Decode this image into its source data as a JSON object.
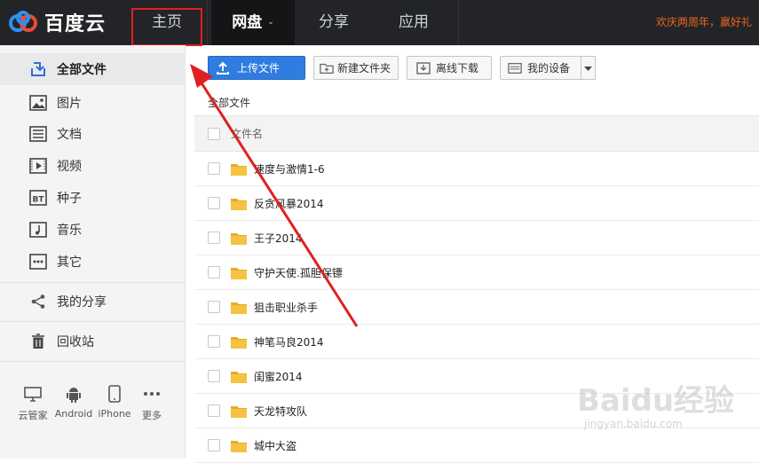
{
  "brand": {
    "name": "百度云"
  },
  "nav": {
    "home": "主页",
    "netdisk": "网盘",
    "share": "分享",
    "apps": "应用"
  },
  "promo": "欢庆两周年，赢好礼",
  "sidebar": {
    "items": [
      {
        "label": "全部文件",
        "icon": "all-files-icon",
        "active": true
      },
      {
        "label": "图片",
        "icon": "image-icon"
      },
      {
        "label": "文档",
        "icon": "document-icon"
      },
      {
        "label": "视频",
        "icon": "video-icon"
      },
      {
        "label": "种子",
        "icon": "torrent-icon"
      },
      {
        "label": "音乐",
        "icon": "music-icon"
      },
      {
        "label": "其它",
        "icon": "other-icon"
      },
      {
        "label": "我的分享",
        "icon": "share-icon"
      },
      {
        "label": "回收站",
        "icon": "trash-icon"
      }
    ],
    "devices": [
      {
        "label": "云管家",
        "icon": "desktop-icon"
      },
      {
        "label": "Android",
        "icon": "android-icon"
      },
      {
        "label": "iPhone",
        "icon": "iphone-icon"
      },
      {
        "label": "更多",
        "icon": "more-icon"
      }
    ]
  },
  "toolbar": {
    "upload": "上传文件",
    "new_folder": "新建文件夹",
    "offline_download": "离线下载",
    "my_devices": "我的设备"
  },
  "breadcrumb": "全部文件",
  "list": {
    "header_name": "文件名",
    "files": [
      "速度与激情1-6",
      "反贪风暴2014",
      "王子2014",
      "守护天使.孤胆保镖",
      "狙击职业杀手",
      "神笔马良2014",
      "闺蜜2014",
      "天龙特攻队",
      "城中大盗"
    ]
  },
  "watermark": {
    "main": "Baidu经验",
    "sub": "jingyan.baidu.com"
  },
  "colors": {
    "topbar": "#222427",
    "accent": "#2f7de1",
    "highlight": "#e02020",
    "folder": "#f5c242"
  }
}
